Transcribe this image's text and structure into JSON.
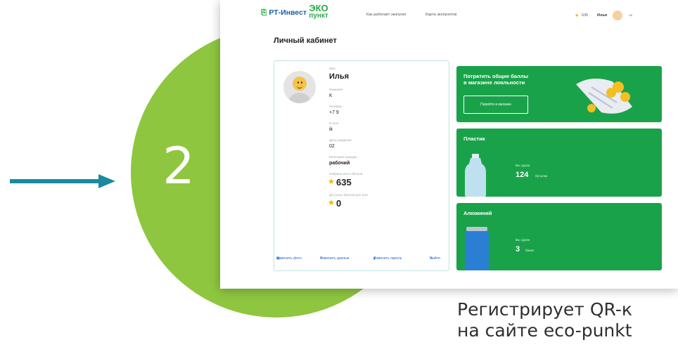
{
  "slide": {
    "step_number": "2",
    "caption_line1": "Регистрирует QR-к",
    "caption_line2": "на сайте eco-punkt",
    "colors": {
      "circle": "#8ec63f",
      "arrow": "#1b8aa0",
      "text": "#2f2f2f"
    }
  },
  "header": {
    "brand_left": "РТ-Инвест",
    "brand_eco_top": "ЭКО",
    "brand_eco_bottom": "пункт",
    "nav": [
      "Как работает экопункт",
      "Карта экопунктов"
    ],
    "user_points": "635",
    "user_name": "Илья",
    "icons": {
      "star": "star-icon",
      "exit": "logout-icon"
    }
  },
  "page": {
    "title": "Личный кабинет"
  },
  "profile": {
    "fields": [
      {
        "label": "Имя",
        "value": "Илья"
      },
      {
        "label": "Фамилия",
        "value": "К"
      },
      {
        "label": "Телефон",
        "value": "+7 9"
      },
      {
        "label": "E-mail",
        "value": "ik"
      },
      {
        "label": "Дата рождения",
        "value": "02"
      },
      {
        "label": "Категория граждан",
        "value": "рабочий"
      }
    ],
    "total_points_label": "Набрано всего баллов",
    "total_points": "635",
    "available_points_label": "Доступно баллов для трат",
    "available_points": "0",
    "actions": [
      "Изменить фото",
      "Изменить данные",
      "Изменить пароль",
      "Выйти"
    ]
  },
  "cards": {
    "shop": {
      "title_line1": "Потратить общие баллы",
      "title_line2": "в магазине лояльности",
      "button": "Перейти в магазин"
    },
    "plastic": {
      "title": "Пластик",
      "label": "Вы сдали",
      "value": "124",
      "unit": "бутылки"
    },
    "aluminum": {
      "title": "Алюминий",
      "label": "Вы сдали",
      "value": "3",
      "unit": "банки"
    },
    "color": "#1aa24a"
  }
}
